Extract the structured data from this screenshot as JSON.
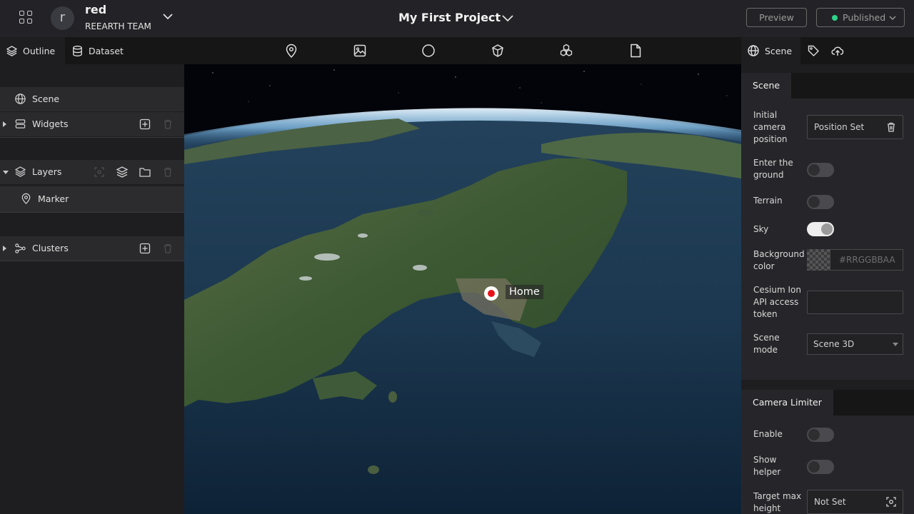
{
  "header": {
    "avatar_initial": "r",
    "user_name": "red",
    "team_name": "REEARTH TEAM",
    "project_title": "My First Project",
    "preview_label": "Preview",
    "publish_label": "Published",
    "publish_status_color": "#2fd38a"
  },
  "left_panel": {
    "tabs": [
      {
        "label": "Outline",
        "icon": "layers-icon",
        "active": true
      },
      {
        "label": "Dataset",
        "icon": "database-icon",
        "active": false
      }
    ],
    "tree": {
      "scene": {
        "label": "Scene",
        "icon": "globe-icon"
      },
      "widgets": {
        "label": "Widgets",
        "icon": "widgets-icon",
        "expanded": false
      },
      "layers": {
        "label": "Layers",
        "icon": "layers-icon",
        "expanded": true
      },
      "marker": {
        "label": "Marker",
        "icon": "map-pin-icon"
      },
      "clusters": {
        "label": "Clusters",
        "icon": "cluster-icon",
        "expanded": false
      }
    }
  },
  "toolbar": {
    "tools": [
      "marker-tool-icon",
      "photo-overlay-tool-icon",
      "sphere-tool-icon",
      "3d-model-tool-icon",
      "3d-tiles-tool-icon",
      "file-tool-icon"
    ]
  },
  "viewport": {
    "marker_label": "Home",
    "marker_color": "#e8121a"
  },
  "right_panel": {
    "tabs": [
      {
        "label": "Scene",
        "icon": "globe-icon",
        "active": true
      },
      {
        "label": "",
        "icon": "tag-icon",
        "active": false
      },
      {
        "label": "",
        "icon": "cloud-upload-icon",
        "active": false
      }
    ],
    "scene_section": {
      "title": "Scene",
      "initial_camera_label": "Initial camera position",
      "initial_camera_value": "Position Set",
      "enter_ground_label": "Enter the ground",
      "enter_ground_on": false,
      "terrain_label": "Terrain",
      "terrain_on": false,
      "sky_label": "Sky",
      "sky_on": true,
      "bg_color_label": "Background color",
      "bg_color_placeholder": "#RRGGBBAA",
      "cesium_token_label": "Cesium Ion API access token",
      "cesium_token_value": "",
      "scene_mode_label": "Scene mode",
      "scene_mode_value": "Scene 3D"
    },
    "camera_limiter_section": {
      "title": "Camera Limiter",
      "enable_label": "Enable",
      "enable_on": false,
      "show_helper_label": "Show helper",
      "show_helper_on": false,
      "target_max_height_label": "Target max height",
      "target_max_height_value": "Not Set"
    }
  }
}
